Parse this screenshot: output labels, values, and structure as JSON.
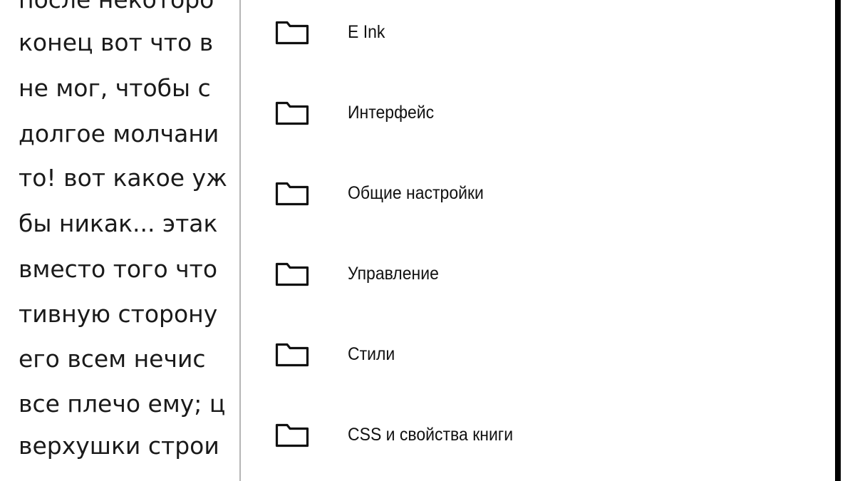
{
  "reader": {
    "lines": [
      "после некоторо",
      "конец вот что в",
      "не мог, чтобы с",
      "долгое молчани",
      "то! вот какое уж",
      "бы никак... этак",
      "вместо того что",
      "тивную сторону",
      "его всем нечис",
      "все плечо ему; ц",
      "верхушки строи"
    ]
  },
  "menu": {
    "items": [
      {
        "label": "E Ink",
        "icon": "folder-icon"
      },
      {
        "label": "Интерфейс",
        "icon": "folder-icon"
      },
      {
        "label": "Общие настройки",
        "icon": "folder-icon"
      },
      {
        "label": "Управление",
        "icon": "folder-icon"
      },
      {
        "label": "Стили",
        "icon": "folder-icon"
      },
      {
        "label": "CSS и свойства книги",
        "icon": "folder-icon"
      }
    ]
  },
  "colors": {
    "background": "#ffffff",
    "text": "#111111",
    "divider": "#b5b5b5",
    "edge": "#000000"
  }
}
